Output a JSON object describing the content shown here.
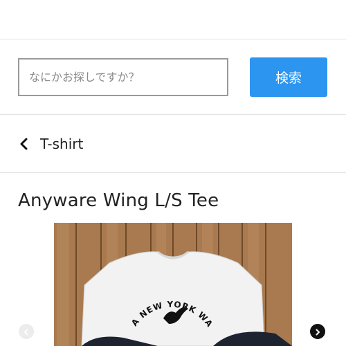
{
  "search": {
    "placeholder": "なにかお探しですか？",
    "button_label": "検索"
  },
  "breadcrumb": {
    "back_label": "T-shirt",
    "icon": "chevron-left-icon"
  },
  "product": {
    "title": "Anyware Wing L/S Tee",
    "image_print_text": "A NEW YORK WARE"
  },
  "gallery": {
    "prev_icon": "chevron-left-icon",
    "next_icon": "chevron-right-icon"
  },
  "colors": {
    "accent": "#2b95f0",
    "divider": "#e3e3e3"
  }
}
